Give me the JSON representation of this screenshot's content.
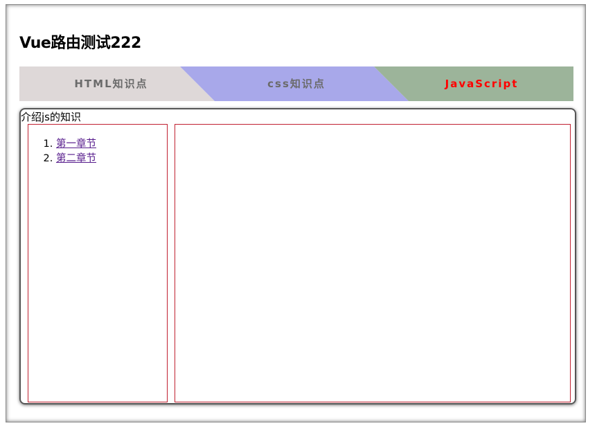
{
  "page": {
    "title": "Vue路由测试222"
  },
  "tabs": [
    {
      "label": "HTML知识点",
      "color": "#ded8d8",
      "text_color": "#6b6b6b",
      "active": false
    },
    {
      "label": "css知识点",
      "color": "#a8a8ea",
      "text_color": "#6b6b6b",
      "active": false
    },
    {
      "label": "JavaScript",
      "color": "#9cb49a",
      "text_color": "#ff0000",
      "active": true
    }
  ],
  "content": {
    "heading": "介绍js的知识",
    "chapters": [
      "第一章节",
      "第二章节"
    ],
    "panel_border_color": "#c02030"
  }
}
